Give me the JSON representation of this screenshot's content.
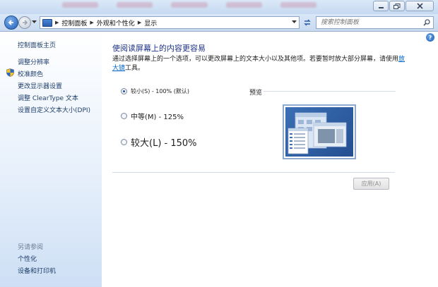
{
  "titlebar": {
    "buttons": [
      "minimize",
      "maximize",
      "close"
    ]
  },
  "nav": {
    "breadcrumbs": [
      "控制面板",
      "外观和个性化",
      "显示"
    ],
    "search_placeholder": "搜索控制面板"
  },
  "sidebar": {
    "home": "控制面板主页",
    "items": [
      {
        "label": "调整分辨率"
      },
      {
        "label": "校准颜色"
      },
      {
        "label": "更改显示器设置"
      },
      {
        "label": "调整 ClearType 文本"
      },
      {
        "label": "设置自定义文本大小(DPI)"
      }
    ],
    "see_also_title": "另请参阅",
    "see_also": [
      {
        "label": "个性化"
      },
      {
        "label": "设备和打印机"
      }
    ]
  },
  "main": {
    "heading": "使阅读屏幕上的内容更容易",
    "description_prefix": "通过选择屏幕上的一个选项，可以更改屏幕上的文本大小以及其他项。若要暂时放大部分屏幕，请使用",
    "magnifier_link": "放大镜",
    "description_suffix": "工具。",
    "options": [
      {
        "label": "较小(S) - 100% (默认)",
        "checked": true
      },
      {
        "label": "中等(M) - 125%",
        "checked": false
      },
      {
        "label": "较大(L) - 150%",
        "checked": false
      }
    ],
    "preview_label": "预览",
    "apply_label": "应用(A)"
  },
  "colors": {
    "link": "#1e3e6a",
    "heading": "#1e3287",
    "sidebar_gradient_end": "#cddff5"
  }
}
